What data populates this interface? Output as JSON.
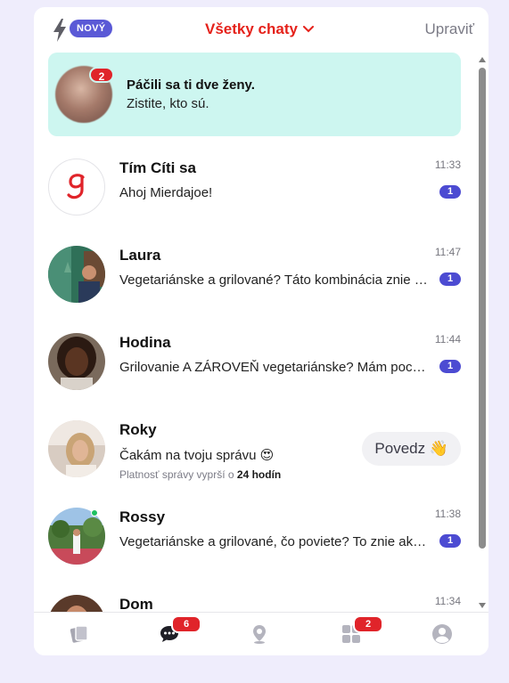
{
  "header": {
    "new_badge": "NOVÝ",
    "filter_label": "Všetky chaty",
    "edit_label": "Upraviť"
  },
  "promo": {
    "count": "2",
    "title": "Páčili sa ti dve ženy.",
    "subtitle": "Zistite, kto sú."
  },
  "chats": [
    {
      "name": "Tím Cíti sa",
      "message": "Ahoj Mierdajoe!",
      "time": "11:33",
      "unread": "1"
    },
    {
      "name": "Laura",
      "message": "Vegetariánske a grilované? Táto kombinácia znie ako dobrý nápad",
      "time": "11:47",
      "unread": "1"
    },
    {
      "name": "Hodina",
      "message": "Grilovanie A ZÁROVEŇ vegetariánske? Mám pocit, že to bude zaujímavé",
      "time": "11:44",
      "unread": "1"
    },
    {
      "name": "Roky",
      "message": "Čakám na tvoju správu 😍",
      "expire_prefix": "Platnosť správy vyprší o ",
      "expire_value": "24 hodín",
      "action": "Povedz 👋"
    },
    {
      "name": "Rossy",
      "message": "Vegetariánske a grilované, čo poviete? To znie ako skvelý nápad",
      "time": "11:38",
      "unread": "1"
    },
    {
      "name": "Dom",
      "message": "",
      "time": "11:34"
    }
  ],
  "nav": {
    "chats_badge": "6",
    "apps_badge": "2"
  },
  "colors": {
    "accent_red": "#e5221b",
    "badge_purple": "#5a59d6",
    "unread_blue": "#4c4bd2",
    "promo_bg": "#cdf6f0",
    "page_bg": "#efedfc"
  }
}
